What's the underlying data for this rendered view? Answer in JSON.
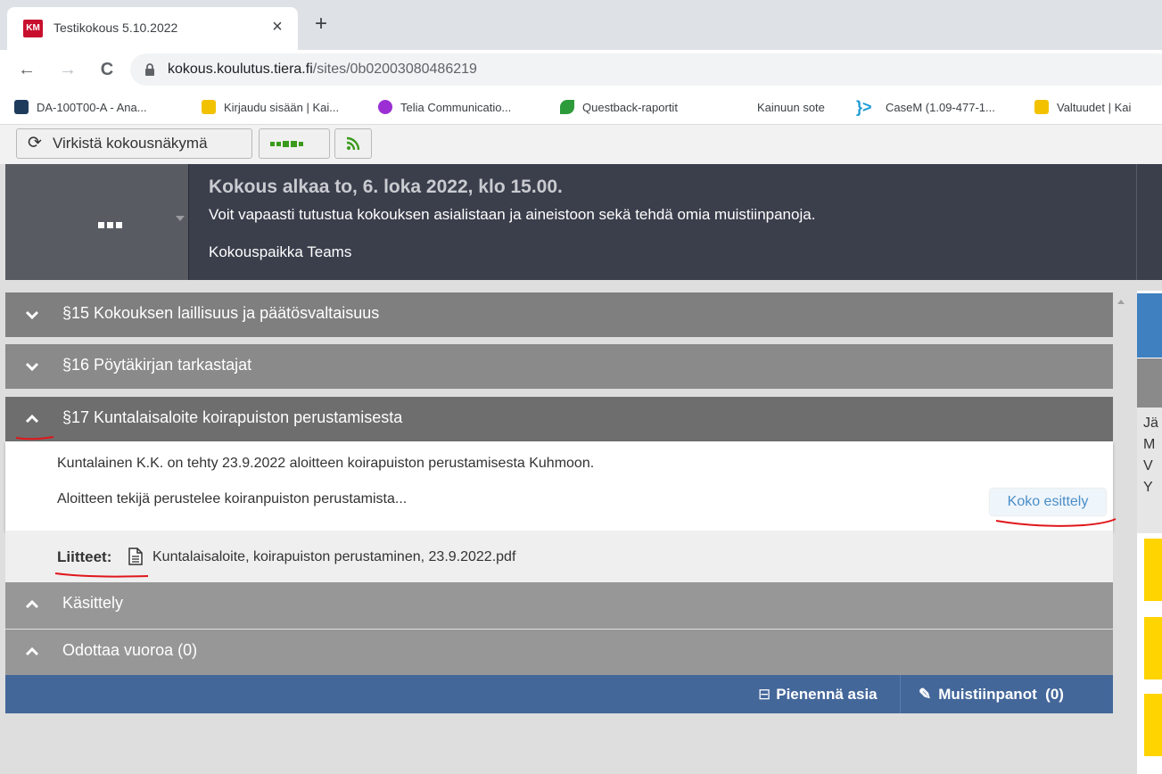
{
  "browser": {
    "tab_title": "Testikokous 5.10.2022",
    "tab_close": "×",
    "new_tab": "+",
    "favicon_text": "KM",
    "url_host": "kokous.koulutus.tiera.fi",
    "url_path": "/sites/0b02003080486219",
    "nav": {
      "back": "←",
      "forward": "→",
      "reload": "C"
    },
    "bookmarks": [
      {
        "label": "DA-100T00-A - Ana...",
        "color": "#1f3b5c"
      },
      {
        "label": "Kirjaudu sisään | Kai...",
        "color": "#f2c200"
      },
      {
        "label": "Telia Communicatio...",
        "color": "#9b2fd4"
      },
      {
        "label": "Questback-raportit",
        "color": "#2e9b3a"
      },
      {
        "label": "Kainuun sote",
        "color": ""
      },
      {
        "label": "CaseM (1.09-477-1...",
        "color": "#1e9bd7"
      },
      {
        "label": "Valtuudet | Kai",
        "color": "#f2c200"
      }
    ]
  },
  "app_toolbar": {
    "refresh_label": "Virkistä kokousnäkymä",
    "refresh_icon": "⟳",
    "rss_icon": "ʀss"
  },
  "meeting": {
    "menu_label": "■■■",
    "title": "Kokous alkaa to, 6. loka 2022, klo 15.00.",
    "description": "Voit vapaasti tutustua kokouksen asialistaan ja aineistoon sekä tehdä omia muistiinpanoja.",
    "place": "Kokouspaikka Teams"
  },
  "agenda": {
    "items": [
      {
        "title": "§15 Kokouksen laillisuus ja päätösvaltaisuus",
        "expanded": false
      },
      {
        "title": "§16 Pöytäkirjan tarkastajat",
        "expanded": false
      },
      {
        "title": "§17 Kuntalaisaloite koirapuiston perustamisesta",
        "expanded": true
      }
    ],
    "item17": {
      "paragraph1": "Kuntalainen K.K. on tehty 23.9.2022 aloitteen koirapuiston perustamisesta Kuhmoon.",
      "paragraph2": "Aloitteen tekijä perustelee koiranpuiston perustamista...",
      "full_intro_button": "Koko esittely",
      "attachments_label": "Liitteet:",
      "attachment_file": "Kuntalaisaloite, koirapuiston perustaminen, 23.9.2022.pdf",
      "sections": [
        {
          "title": "Käsittely"
        },
        {
          "title": "Odottaa vuoroa (0)"
        }
      ],
      "minimize_label": "Pienennä asia",
      "minimize_icon": "⊟",
      "notes_label": "Muistiinpanot  (0)",
      "notes_icon": "✎"
    }
  },
  "right_panel": {
    "letters": [
      "Jä",
      "M",
      "V",
      "Y"
    ]
  },
  "colors": {
    "footer_blue": "#44679a",
    "header_dark": "#3b3f4c",
    "annotation_red": "#e0161b",
    "link_blue": "#4b8ec8"
  }
}
